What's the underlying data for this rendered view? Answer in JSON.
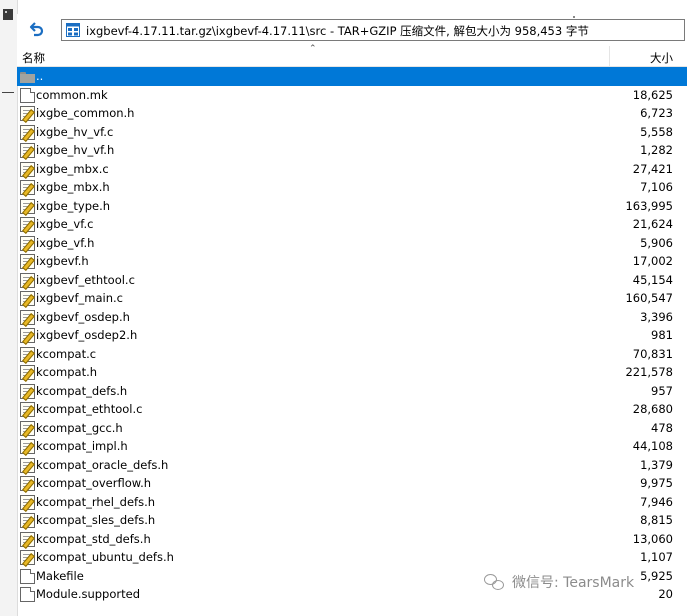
{
  "toolbar": {
    "path": "ixgbevf-4.17.11.tar.gz\\ixgbevf-4.17.11\\src - TAR+GZIP 压缩文件, 解包大小为 958,453 字节"
  },
  "columns": {
    "name": "名称",
    "size": "大小"
  },
  "files": [
    {
      "name": "..",
      "size": "",
      "icon": "folder-icon"
    },
    {
      "name": "common.mk",
      "size": "18,625",
      "icon": "plain-file-icon"
    },
    {
      "name": "ixgbe_common.h",
      "size": "6,723",
      "icon": "edit-file-icon"
    },
    {
      "name": "ixgbe_hv_vf.c",
      "size": "5,558",
      "icon": "edit-file-icon"
    },
    {
      "name": "ixgbe_hv_vf.h",
      "size": "1,282",
      "icon": "edit-file-icon"
    },
    {
      "name": "ixgbe_mbx.c",
      "size": "27,421",
      "icon": "edit-file-icon"
    },
    {
      "name": "ixgbe_mbx.h",
      "size": "7,106",
      "icon": "edit-file-icon"
    },
    {
      "name": "ixgbe_type.h",
      "size": "163,995",
      "icon": "edit-file-icon"
    },
    {
      "name": "ixgbe_vf.c",
      "size": "21,624",
      "icon": "edit-file-icon"
    },
    {
      "name": "ixgbe_vf.h",
      "size": "5,906",
      "icon": "edit-file-icon"
    },
    {
      "name": "ixgbevf.h",
      "size": "17,002",
      "icon": "edit-file-icon"
    },
    {
      "name": "ixgbevf_ethtool.c",
      "size": "45,154",
      "icon": "edit-file-icon"
    },
    {
      "name": "ixgbevf_main.c",
      "size": "160,547",
      "icon": "edit-file-icon"
    },
    {
      "name": "ixgbevf_osdep.h",
      "size": "3,396",
      "icon": "edit-file-icon"
    },
    {
      "name": "ixgbevf_osdep2.h",
      "size": "981",
      "icon": "edit-file-icon"
    },
    {
      "name": "kcompat.c",
      "size": "70,831",
      "icon": "edit-file-icon"
    },
    {
      "name": "kcompat.h",
      "size": "221,578",
      "icon": "edit-file-icon"
    },
    {
      "name": "kcompat_defs.h",
      "size": "957",
      "icon": "edit-file-icon"
    },
    {
      "name": "kcompat_ethtool.c",
      "size": "28,680",
      "icon": "edit-file-icon"
    },
    {
      "name": "kcompat_gcc.h",
      "size": "478",
      "icon": "edit-file-icon"
    },
    {
      "name": "kcompat_impl.h",
      "size": "44,108",
      "icon": "edit-file-icon"
    },
    {
      "name": "kcompat_oracle_defs.h",
      "size": "1,379",
      "icon": "edit-file-icon"
    },
    {
      "name": "kcompat_overflow.h",
      "size": "9,975",
      "icon": "edit-file-icon"
    },
    {
      "name": "kcompat_rhel_defs.h",
      "size": "7,946",
      "icon": "edit-file-icon"
    },
    {
      "name": "kcompat_sles_defs.h",
      "size": "8,815",
      "icon": "edit-file-icon"
    },
    {
      "name": "kcompat_std_defs.h",
      "size": "13,060",
      "icon": "edit-file-icon"
    },
    {
      "name": "kcompat_ubuntu_defs.h",
      "size": "1,107",
      "icon": "edit-file-icon"
    },
    {
      "name": "Makefile",
      "size": "5,925",
      "icon": "plain-file-icon"
    },
    {
      "name": "Module.supported",
      "size": "20",
      "icon": "plain-file-icon"
    }
  ],
  "watermark": {
    "text": "微信号: TearsMark"
  },
  "colors": {
    "selection": "#0078d7",
    "accent_icon": "#1b6ec2"
  }
}
